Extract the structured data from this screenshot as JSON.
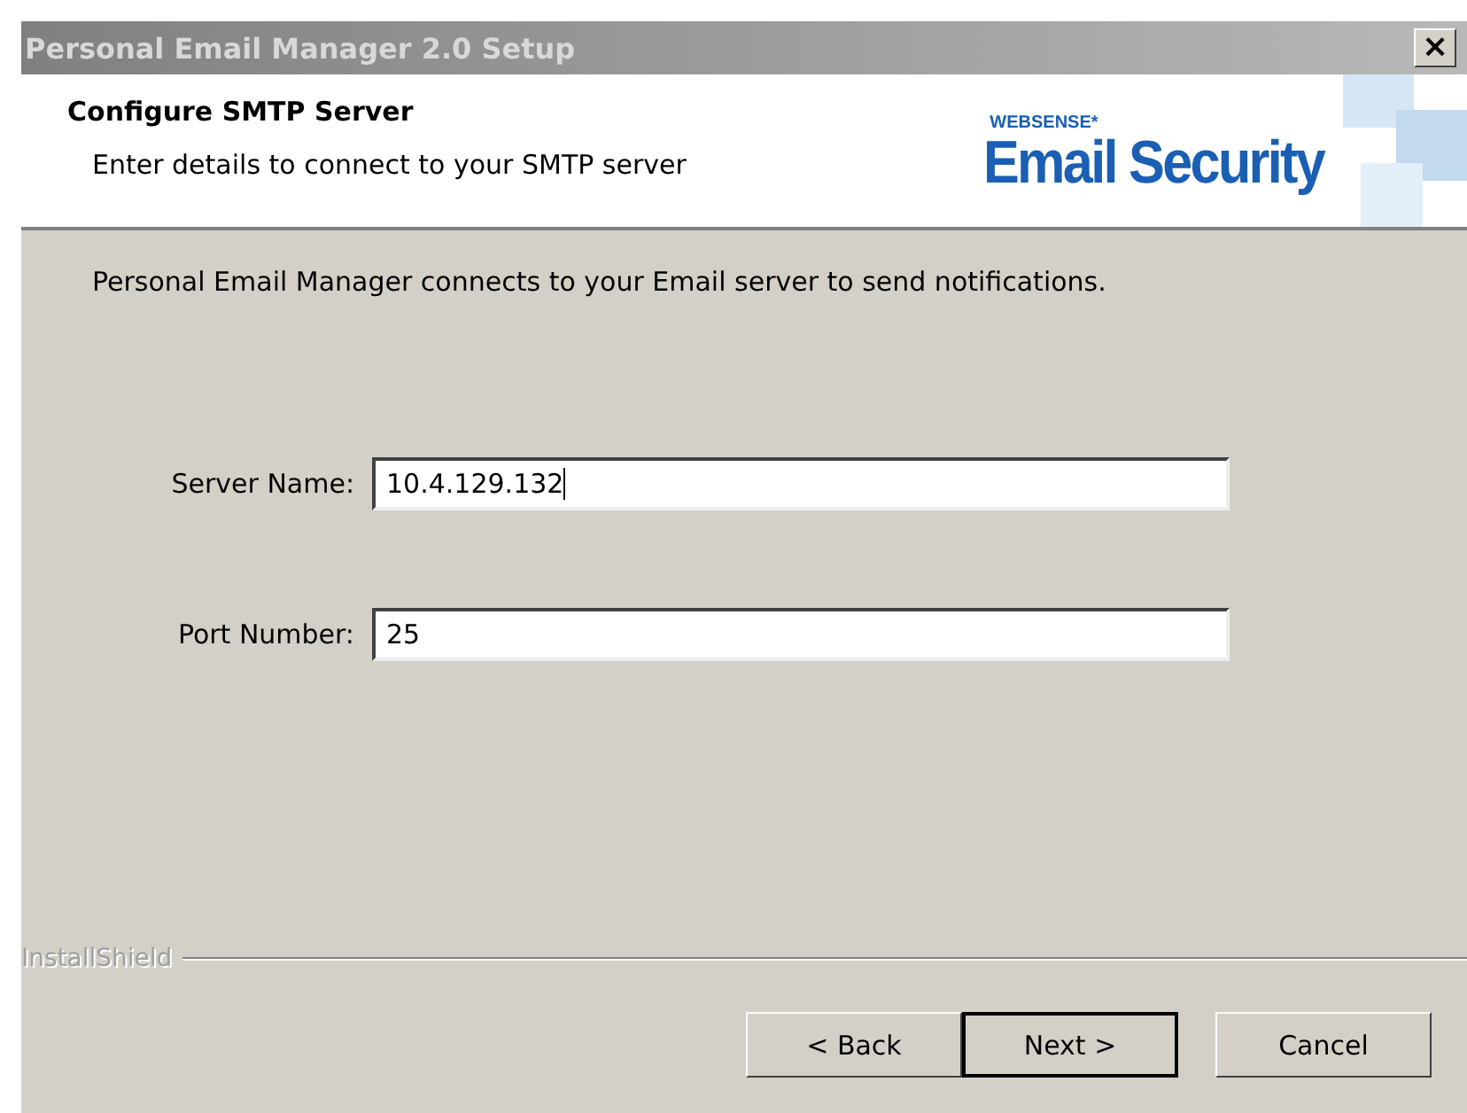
{
  "window": {
    "title": "Personal Email Manager 2.0 Setup",
    "close": "×"
  },
  "header": {
    "title": "Configure SMTP Server",
    "subtitle": "Enter details to connect to your SMTP server",
    "logo_small": "WEBSENSE*",
    "logo_large": "Email Security"
  },
  "intro": "Personal Email Manager connects to your Email server to send notifications.",
  "fields": [
    {
      "label": "Server Name:",
      "value": "10.4.129.132",
      "focused": true
    },
    {
      "label": "Port Number:",
      "value": "25",
      "focused": false
    }
  ],
  "footer_brand": "InstallShield",
  "buttons": [
    {
      "label": "< Back",
      "default": false
    },
    {
      "label": "Next >",
      "default": true
    },
    {
      "label": "Cancel",
      "default": false
    }
  ]
}
